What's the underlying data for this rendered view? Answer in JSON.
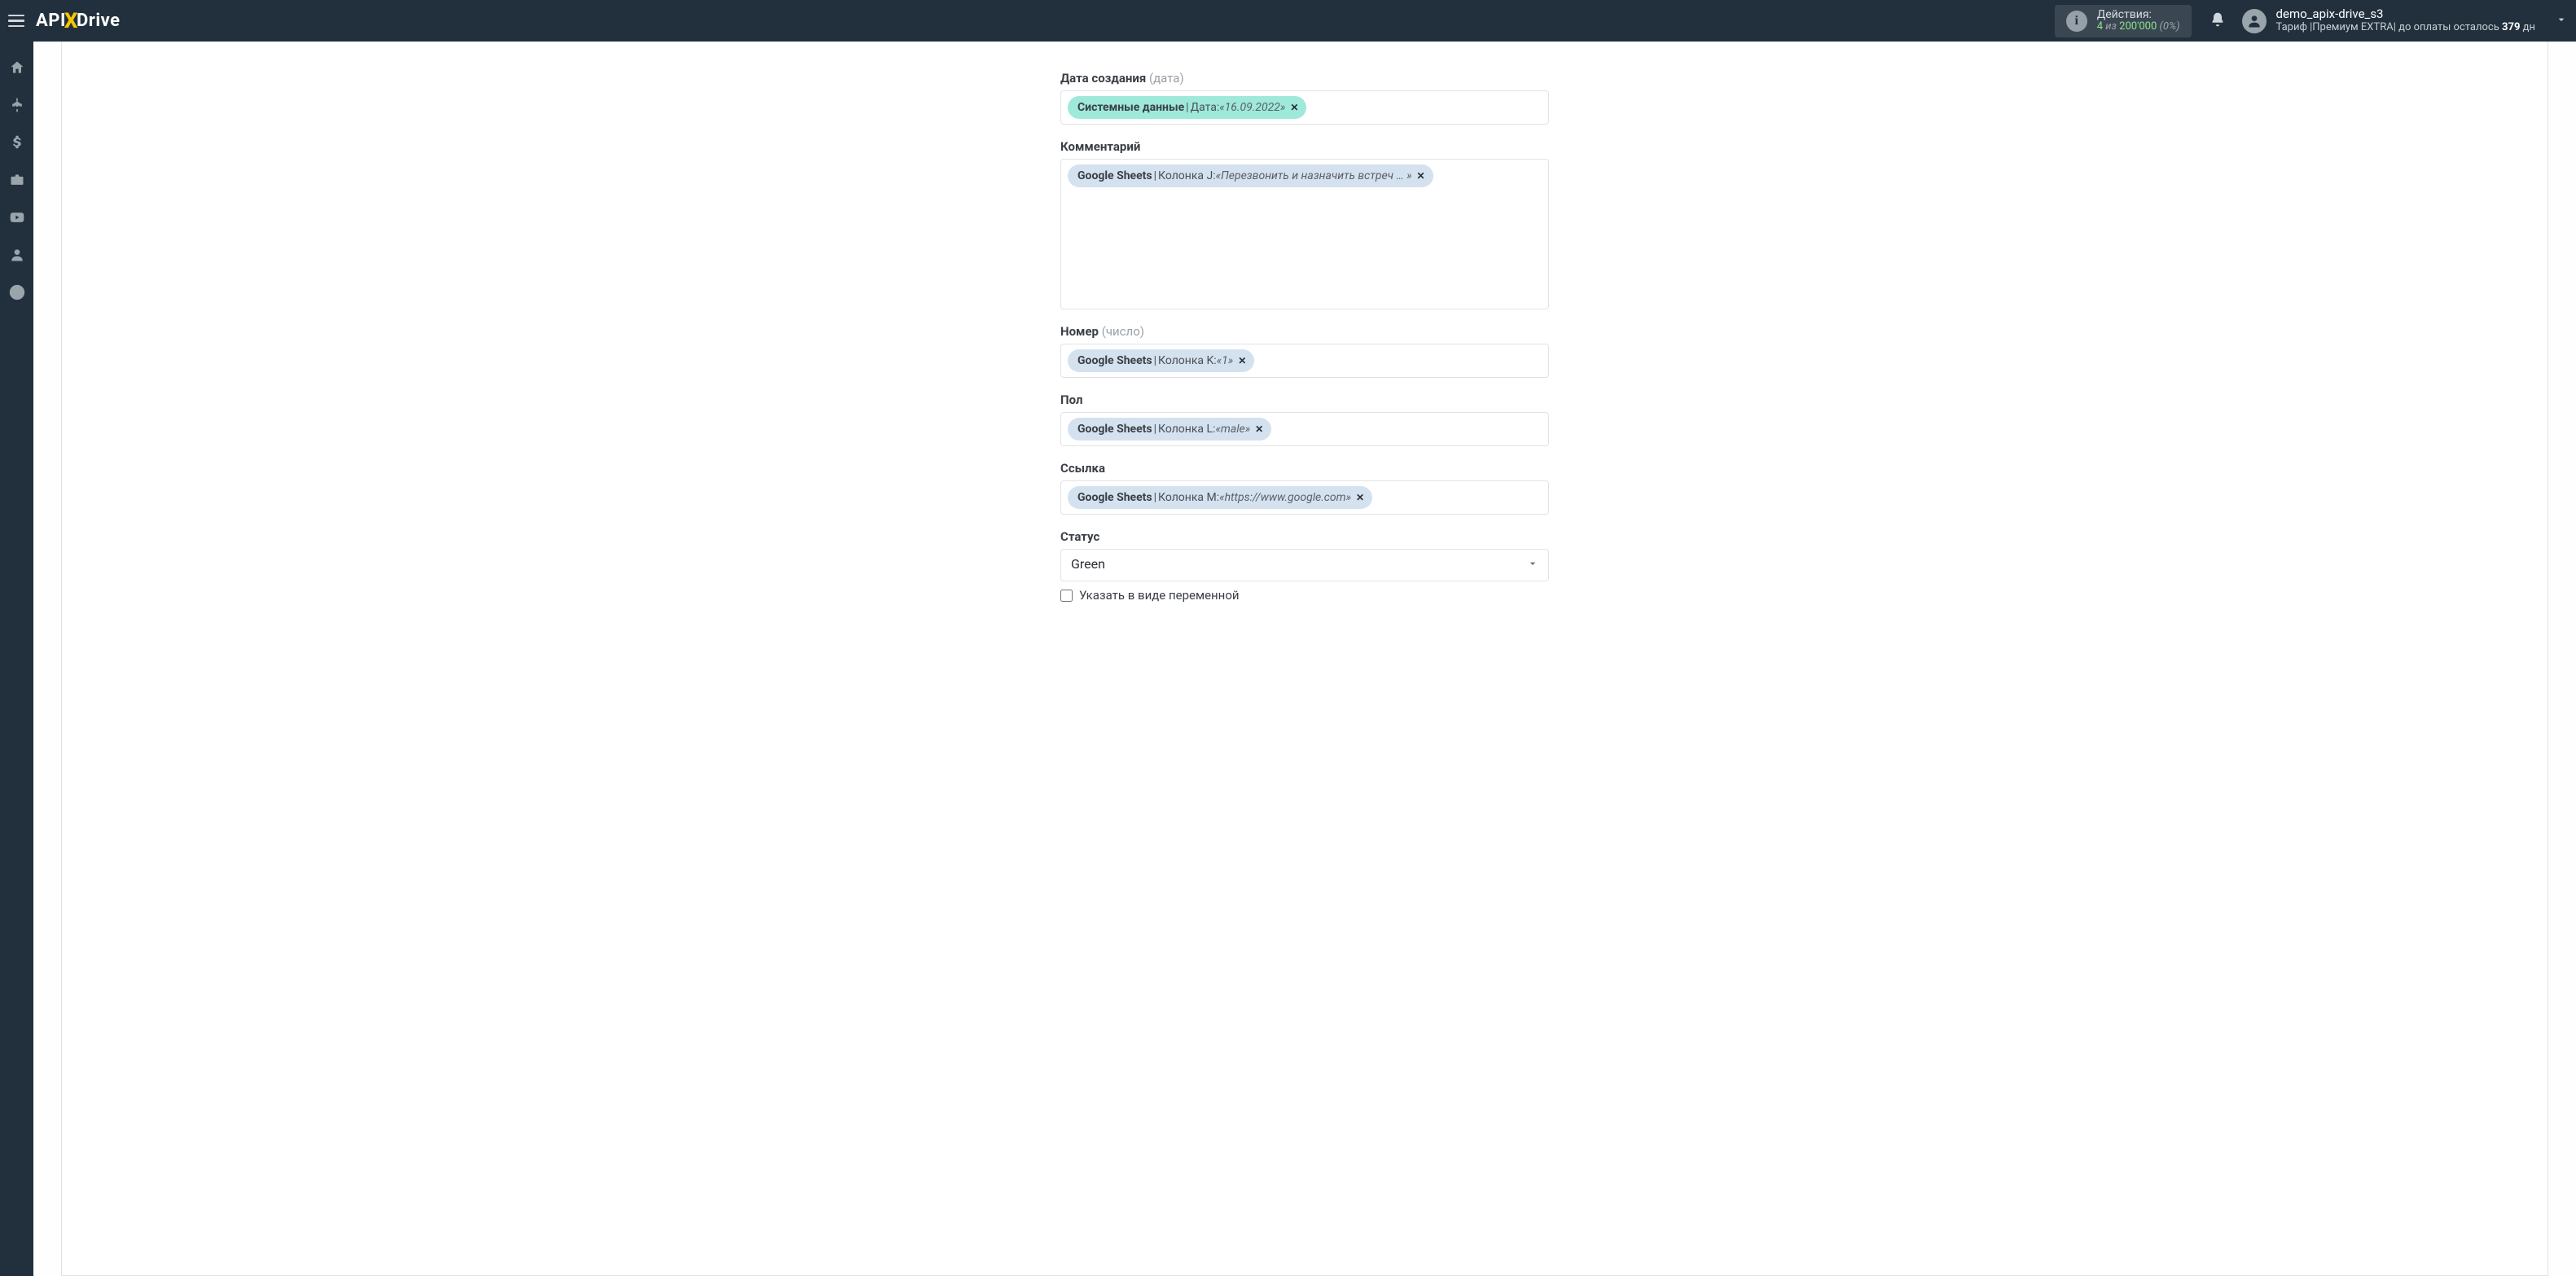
{
  "header": {
    "logo": {
      "api": "API",
      "x": "X",
      "drive": "Drive"
    },
    "actions": {
      "title": "Действия:",
      "count": "4",
      "of": "из",
      "total": "200'000",
      "pct": "(0%)"
    },
    "user": {
      "name": "demo_apix-drive_s3",
      "tariff_prefix": "Тариф |",
      "tariff_name": "Премиум EXTRA",
      "tariff_mid": "| до оплаты осталось ",
      "days": "379",
      "days_suffix": " дн"
    }
  },
  "sidebar_icons": [
    "home",
    "sitemap",
    "dollar",
    "briefcase",
    "youtube",
    "user",
    "help"
  ],
  "form": {
    "fields": [
      {
        "id": "date_created",
        "label": "Дата создания",
        "hint": "(дата)",
        "height": "normal",
        "chips": [
          {
            "style": "teal",
            "source": "Системные данные",
            "col": "Дата:",
            "value": "16.09.2022"
          }
        ]
      },
      {
        "id": "comment",
        "label": "Комментарий",
        "hint": "",
        "height": "tall",
        "chips": [
          {
            "style": "blue",
            "source": "Google Sheets",
            "col": "Колонка J:",
            "value": "Перезвонить и назначить встреч … "
          }
        ]
      },
      {
        "id": "number",
        "label": "Номер",
        "hint": "(число)",
        "height": "normal",
        "chips": [
          {
            "style": "blue",
            "source": "Google Sheets",
            "col": "Колонка K:",
            "value": "1"
          }
        ]
      },
      {
        "id": "gender",
        "label": "Пол",
        "hint": "",
        "height": "normal",
        "chips": [
          {
            "style": "blue",
            "source": "Google Sheets",
            "col": "Колонка L:",
            "value": "male"
          }
        ]
      },
      {
        "id": "link",
        "label": "Ссылка",
        "hint": "",
        "height": "normal",
        "chips": [
          {
            "style": "blue",
            "source": "Google Sheets",
            "col": "Колонка M:",
            "value": "https://www.google.com"
          }
        ]
      }
    ],
    "status": {
      "label": "Статус",
      "value": "Green",
      "checkbox_label": "Указать в виде переменной",
      "checkbox_checked": false
    }
  }
}
